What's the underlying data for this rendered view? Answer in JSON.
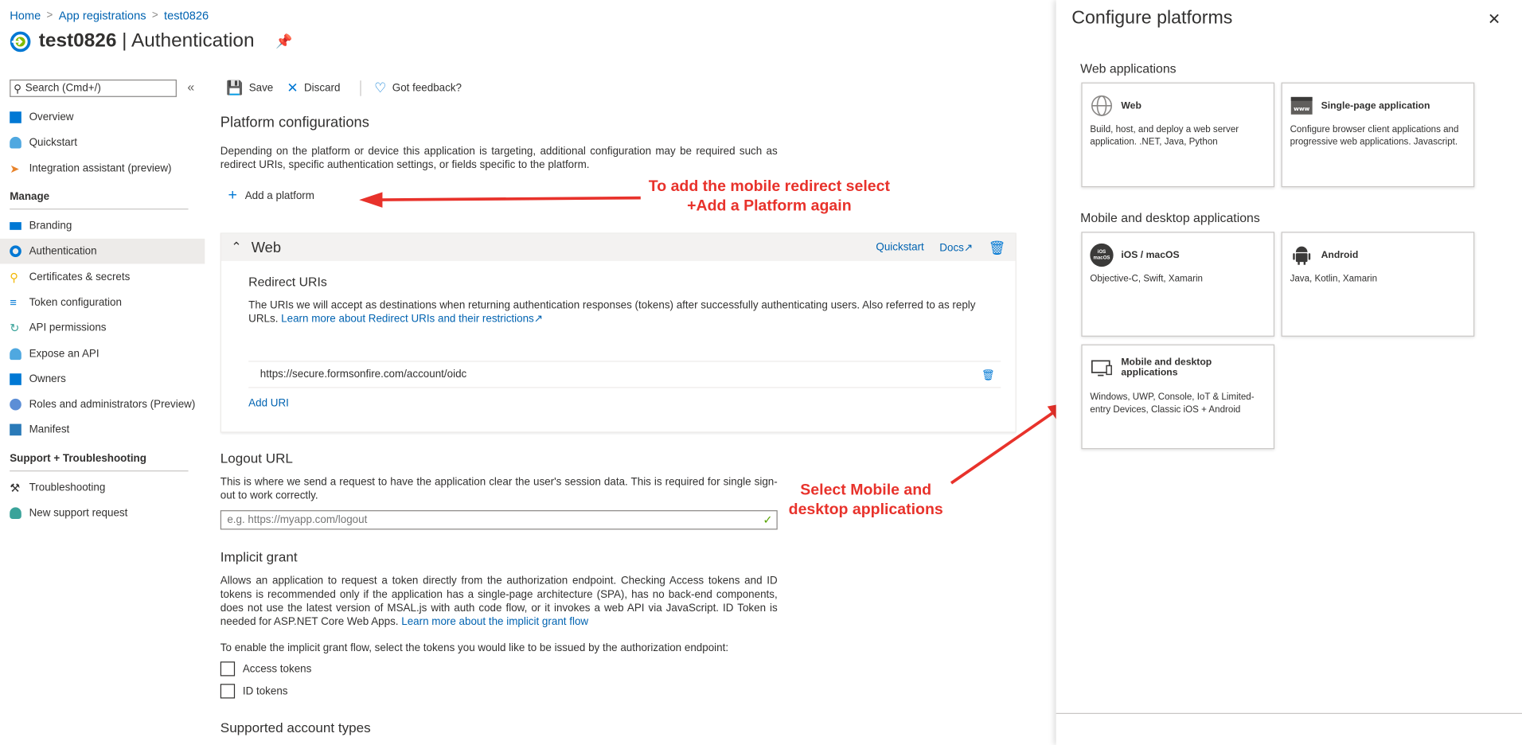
{
  "breadcrumb": [
    "Home",
    "App registrations",
    "test0826"
  ],
  "page": {
    "app_name": "test0826",
    "section": "| Authentication"
  },
  "sidebar": {
    "search_placeholder": "Search (Cmd+/)",
    "items_top": [
      "Overview",
      "Quickstart",
      "Integration assistant (preview)"
    ],
    "manage_heading": "Manage",
    "manage_items": [
      "Branding",
      "Authentication",
      "Certificates & secrets",
      "Token configuration",
      "API permissions",
      "Expose an API",
      "Owners",
      "Roles and administrators (Preview)",
      "Manifest"
    ],
    "support_heading": "Support + Troubleshooting",
    "support_items": [
      "Troubleshooting",
      "New support request"
    ]
  },
  "toolbar": {
    "save": "Save",
    "discard": "Discard",
    "feedback": "Got feedback?"
  },
  "platform": {
    "title": "Platform configurations",
    "description": "Depending on the platform or device this application is targeting, additional configuration may be required such as redirect URIs, specific authentication settings, or fields specific to the platform.",
    "add_label": "Add a platform"
  },
  "web_card": {
    "title": "Web",
    "quickstart": "Quickstart",
    "docs": "Docs",
    "redirect_title": "Redirect URIs",
    "redirect_desc": "The URIs we will accept as destinations when returning authentication responses (tokens) after successfully authenticating users. Also referred to as reply URLs.",
    "redirect_link": "Learn more about Redirect URIs and their restrictions",
    "uri": "https://secure.formsonfire.com/account/oidc",
    "add_uri": "Add URI"
  },
  "logout": {
    "title": "Logout URL",
    "desc": "This is where we send a request to have the application clear the user's session data. This is required for single sign-out to work correctly.",
    "placeholder": "e.g. https://myapp.com/logout"
  },
  "implicit": {
    "title": "Implicit grant",
    "desc": "Allows an application to request a token directly from the authorization endpoint. Checking Access tokens and ID tokens is recommended only if the application has a single-page architecture (SPA), has no back-end components, does not use the latest version of MSAL.js with auth code flow, or it invokes a web API via JavaScript. ID Token is needed for ASP.NET Core Web Apps.",
    "link": "Learn more about the implicit grant flow",
    "enable_text": "To enable the implicit grant flow, select the tokens you would like to be issued by the authorization endpoint:",
    "access_tokens": "Access tokens",
    "id_tokens": "ID tokens"
  },
  "supported": {
    "title": "Supported account types"
  },
  "annotations": {
    "top_line1": "To add the mobile redirect select",
    "top_line2": "+Add a Platform again",
    "bottom_line1": "Select Mobile and",
    "bottom_line2": "desktop applications",
    "color": "#e8322b"
  },
  "panel": {
    "title": "Configure platforms",
    "web_group": "Web applications",
    "mobile_group": "Mobile and desktop applications",
    "tiles": {
      "web": {
        "title": "Web",
        "desc": "Build, host, and deploy a web server application. .NET, Java, Python"
      },
      "spa": {
        "title": "Single-page application",
        "desc": "Configure browser client applications and progressive web applications. Javascript."
      },
      "ios": {
        "title": "iOS / macOS",
        "desc": "Objective-C, Swift, Xamarin",
        "icon_text": "iOS macOS"
      },
      "android": {
        "title": "Android",
        "desc": "Java, Kotlin, Xamarin"
      },
      "desktop": {
        "title": "Mobile and desktop applications",
        "desc": "Windows, UWP, Console, IoT & Limited-entry Devices, Classic iOS + Android"
      }
    }
  }
}
